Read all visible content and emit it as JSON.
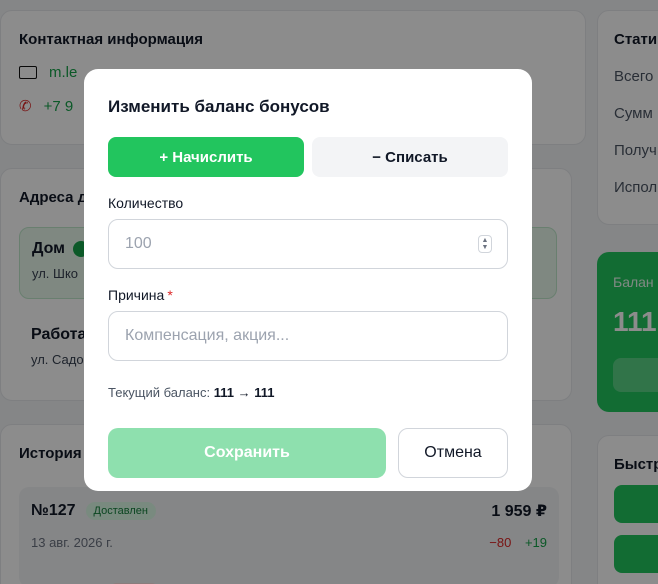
{
  "contact": {
    "title": "Контактная информация",
    "email": "m.le",
    "phone": "+7 9"
  },
  "addresses": {
    "title": "Адреса д",
    "home": {
      "title": "Дом",
      "line": "ул. Шко"
    },
    "work": {
      "title": "Работа",
      "line": "ул. Садо"
    }
  },
  "history": {
    "title": "История",
    "orders": [
      {
        "number": "№127",
        "status": "Доставлен",
        "total": "1 959 ₽",
        "date": "13 авг. 2026 г.",
        "minus": "−80",
        "plus": "+19"
      }
    ]
  },
  "stats": {
    "title": "Стати",
    "rows": [
      "Всего",
      "Сумм",
      "Получ",
      "Испол"
    ]
  },
  "balance_card": {
    "label": "Балан",
    "value": "111"
  },
  "quick": {
    "title": "Быстр"
  },
  "modal": {
    "title": "Изменить баланс бонусов",
    "mode_add": "+ Начислить",
    "mode_subtract": "− Списать",
    "amount_label": "Количество",
    "amount_placeholder": "100",
    "reason_label": "Причина",
    "reason_required": "*",
    "reason_placeholder": "Компенсация, акция...",
    "current_prefix": "Текущий баланс:",
    "current_value": "111 → 111",
    "save": "Сохранить",
    "cancel": "Отмена"
  },
  "colors": {
    "accent": "#22c55e",
    "accent_disabled": "#8ee0ae",
    "danger": "#dc2626"
  }
}
